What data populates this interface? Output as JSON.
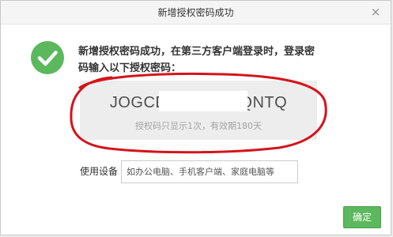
{
  "dialog": {
    "title": "新增授权密码成功",
    "close_label": "×"
  },
  "success": {
    "icon": "check-circle-icon",
    "color": "#5cb85c",
    "message": "新增授权密码成功，在第三方客户端登录时，登录密码输入以下授权密码："
  },
  "auth_code": {
    "value": "JOGCD            WQNTQ",
    "note": "授权码只显示1次，有效期180天"
  },
  "annotation_color": "#d4141a",
  "device": {
    "label": "使用设备",
    "placeholder": "如办公电脑、手机客户端、家庭电脑等",
    "value": ""
  },
  "footer": {
    "confirm_label": "确定",
    "confirm_color": "#5cb85c"
  }
}
